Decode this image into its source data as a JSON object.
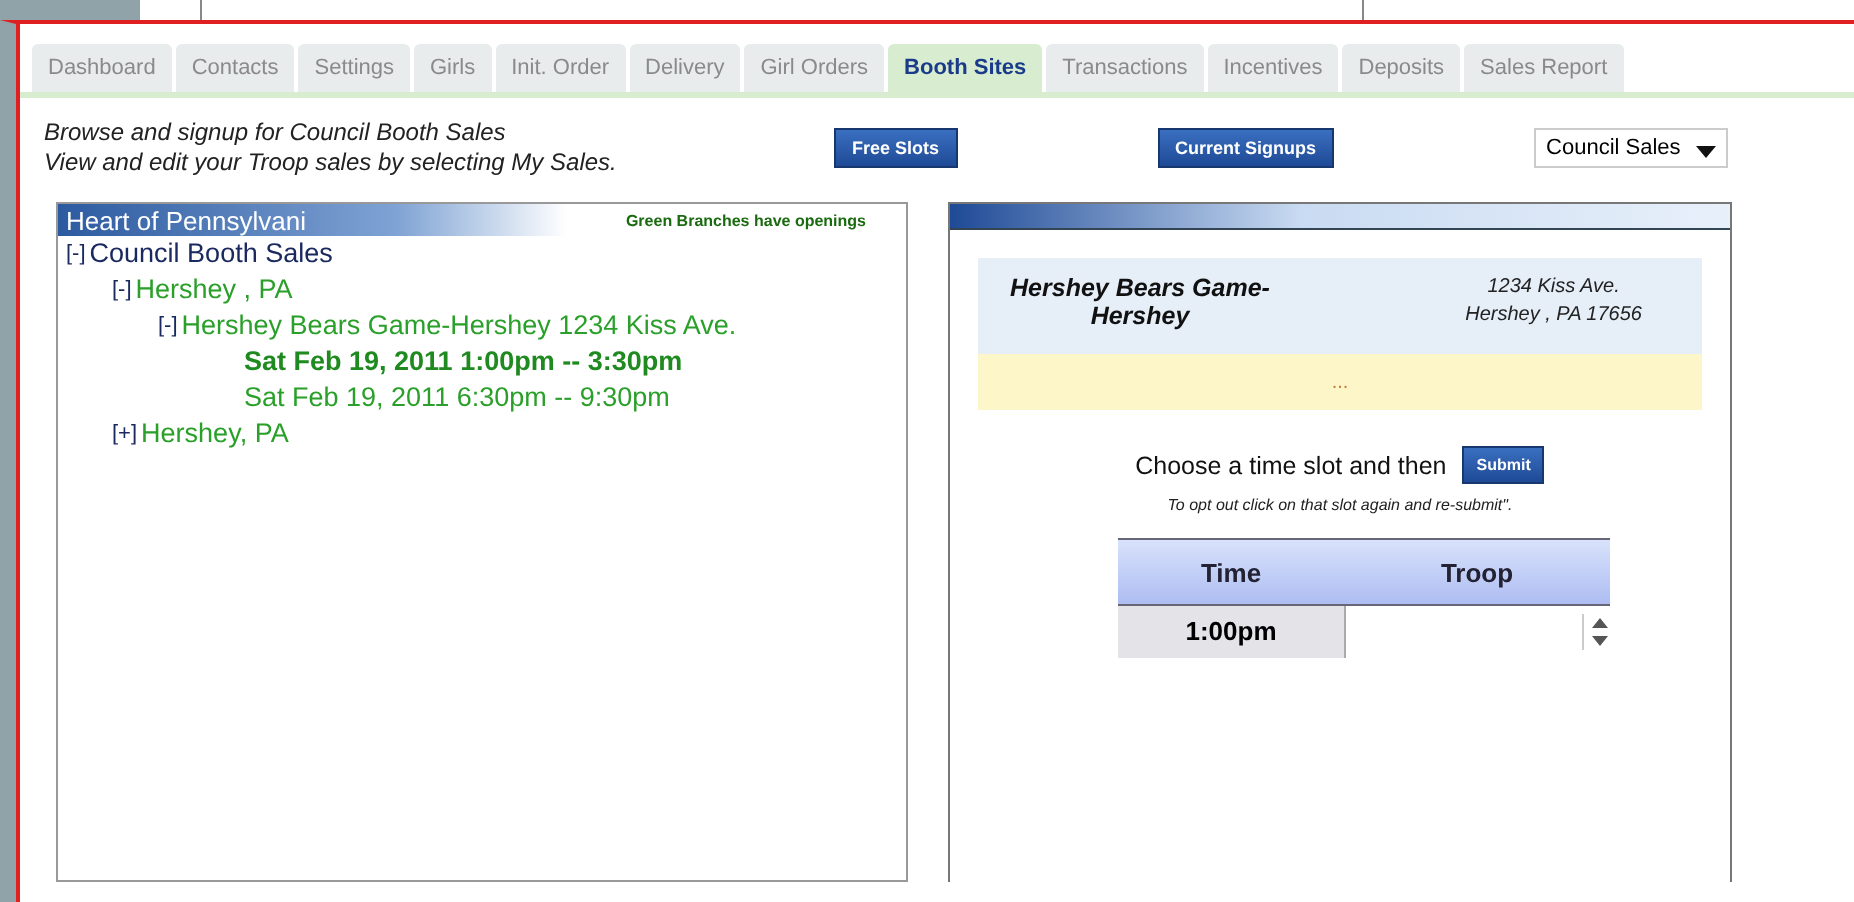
{
  "tabs": [
    {
      "label": "Dashboard",
      "selected": false
    },
    {
      "label": "Contacts",
      "selected": false
    },
    {
      "label": "Settings",
      "selected": false
    },
    {
      "label": "Girls",
      "selected": false
    },
    {
      "label": "Init. Order",
      "selected": false
    },
    {
      "label": "Delivery",
      "selected": false
    },
    {
      "label": "Girl Orders",
      "selected": false
    },
    {
      "label": "Booth Sites",
      "selected": true
    },
    {
      "label": "Transactions",
      "selected": false
    },
    {
      "label": "Incentives",
      "selected": false
    },
    {
      "label": "Deposits",
      "selected": false
    },
    {
      "label": "Sales Report",
      "selected": false
    }
  ],
  "intro": [
    "Browse and signup for Council Booth Sales",
    "View and edit your Troop sales by selecting My Sales."
  ],
  "buttons": [
    "Free Slots",
    "Current Signups"
  ],
  "sales_select": {
    "value": "Council Sales"
  },
  "tree_panel": {
    "title": "Heart of Pennsylvani",
    "legend": "Green Branches have openings",
    "tree": [
      {
        "toggle": "[-]",
        "label": "Council Booth Sales",
        "has_openings": false,
        "children": [
          {
            "toggle": "[-]",
            "label": "Hershey , PA",
            "has_openings": true,
            "children": [
              {
                "toggle": "[-]",
                "label": "Hershey Bears Game-Hershey 1234 Kiss Ave.",
                "has_openings": true,
                "children": [
                  {
                    "label": "Sat Feb 19, 2011   1:00pm -- 3:30pm",
                    "has_openings": true,
                    "selected": true
                  },
                  {
                    "label": "Sat Feb 19, 2011   6:30pm -- 9:30pm",
                    "has_openings": true,
                    "selected": false
                  }
                ]
              }
            ]
          },
          {
            "toggle": "[+]",
            "label": "Hershey, PA",
            "has_openings": true
          }
        ]
      }
    ]
  },
  "detail_panel": {
    "site_name": "Hershey Bears Game-Hershey",
    "address": [
      "1234 Kiss Ave.",
      "Hershey , PA  17656"
    ],
    "notice": "...",
    "instruction": "Choose a time slot and then",
    "submit": "Submit",
    "opt_out_note": "To opt out click on that slot again and re-submit\".",
    "table": {
      "columns": [
        "Time",
        "Troop"
      ],
      "rows": [
        {
          "time": "1:00pm"
        }
      ]
    }
  }
}
